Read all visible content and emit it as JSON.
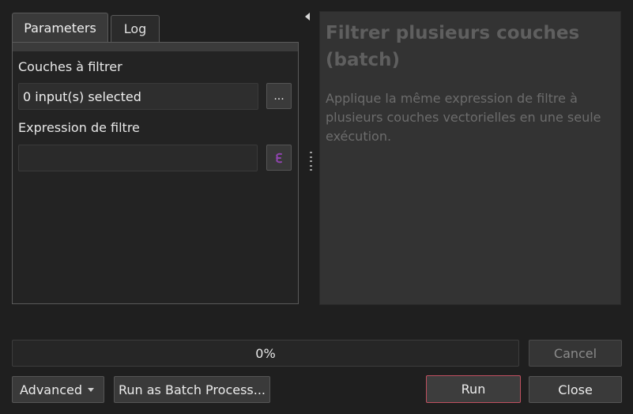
{
  "tabs": {
    "parameters": "Parameters",
    "log": "Log"
  },
  "parameters": {
    "layers_label": "Couches à filtrer",
    "layers_value": "0 input(s) selected",
    "ellipsis_button": "...",
    "expression_label": "Expression de filtre",
    "expression_value": "",
    "expression_icon": "epsilon-expression-icon"
  },
  "help": {
    "title": "Filtrer plusieurs couches (batch)",
    "description": "Applique la même expression de filtre à plusieurs couches vectorielles en une seule exécution."
  },
  "progress": {
    "value": 0,
    "label": "0%"
  },
  "buttons": {
    "cancel": "Cancel",
    "advanced": "Advanced",
    "batch": "Run as Batch Process...",
    "run": "Run",
    "close": "Close"
  },
  "colors": {
    "run_border": "#c05060",
    "expression_icon": "#8e44ad"
  }
}
